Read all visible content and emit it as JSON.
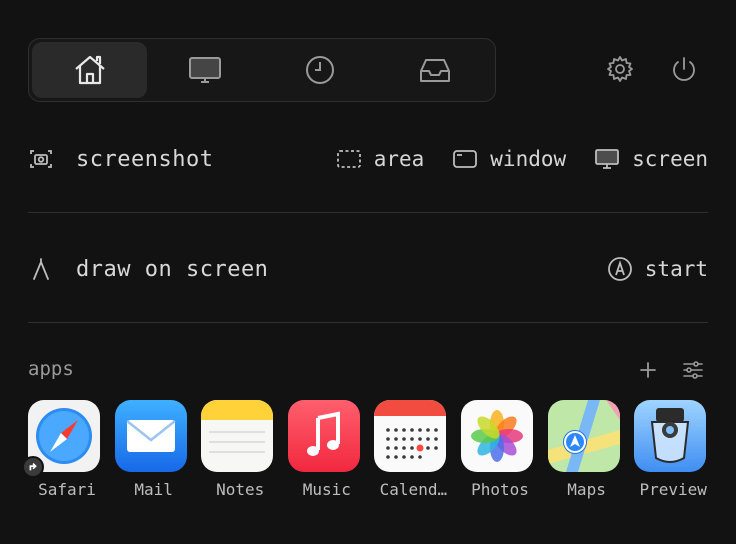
{
  "tabs": [
    {
      "icon": "home-icon",
      "active": true
    },
    {
      "icon": "display-icon",
      "active": false
    },
    {
      "icon": "clock-icon",
      "active": false
    },
    {
      "icon": "tray-icon",
      "active": false
    }
  ],
  "top_icons": [
    "gear-icon",
    "power-icon"
  ],
  "screenshot": {
    "label": "screenshot",
    "options": [
      {
        "label": "area",
        "icon": "dashed-rect-icon"
      },
      {
        "label": "window",
        "icon": "window-icon"
      },
      {
        "label": "screen",
        "icon": "monitor-icon"
      }
    ]
  },
  "draw": {
    "label": "draw on screen",
    "action": "start"
  },
  "apps": {
    "title": "apps",
    "items": [
      {
        "name": "Safari"
      },
      {
        "name": "Mail"
      },
      {
        "name": "Notes"
      },
      {
        "name": "Music"
      },
      {
        "name": "Calend…"
      },
      {
        "name": "Photos"
      },
      {
        "name": "Maps"
      },
      {
        "name": "Preview"
      }
    ]
  },
  "colors": {
    "background": "#121212",
    "text": "#d6d6d6",
    "divider": "#2e2e2e"
  }
}
